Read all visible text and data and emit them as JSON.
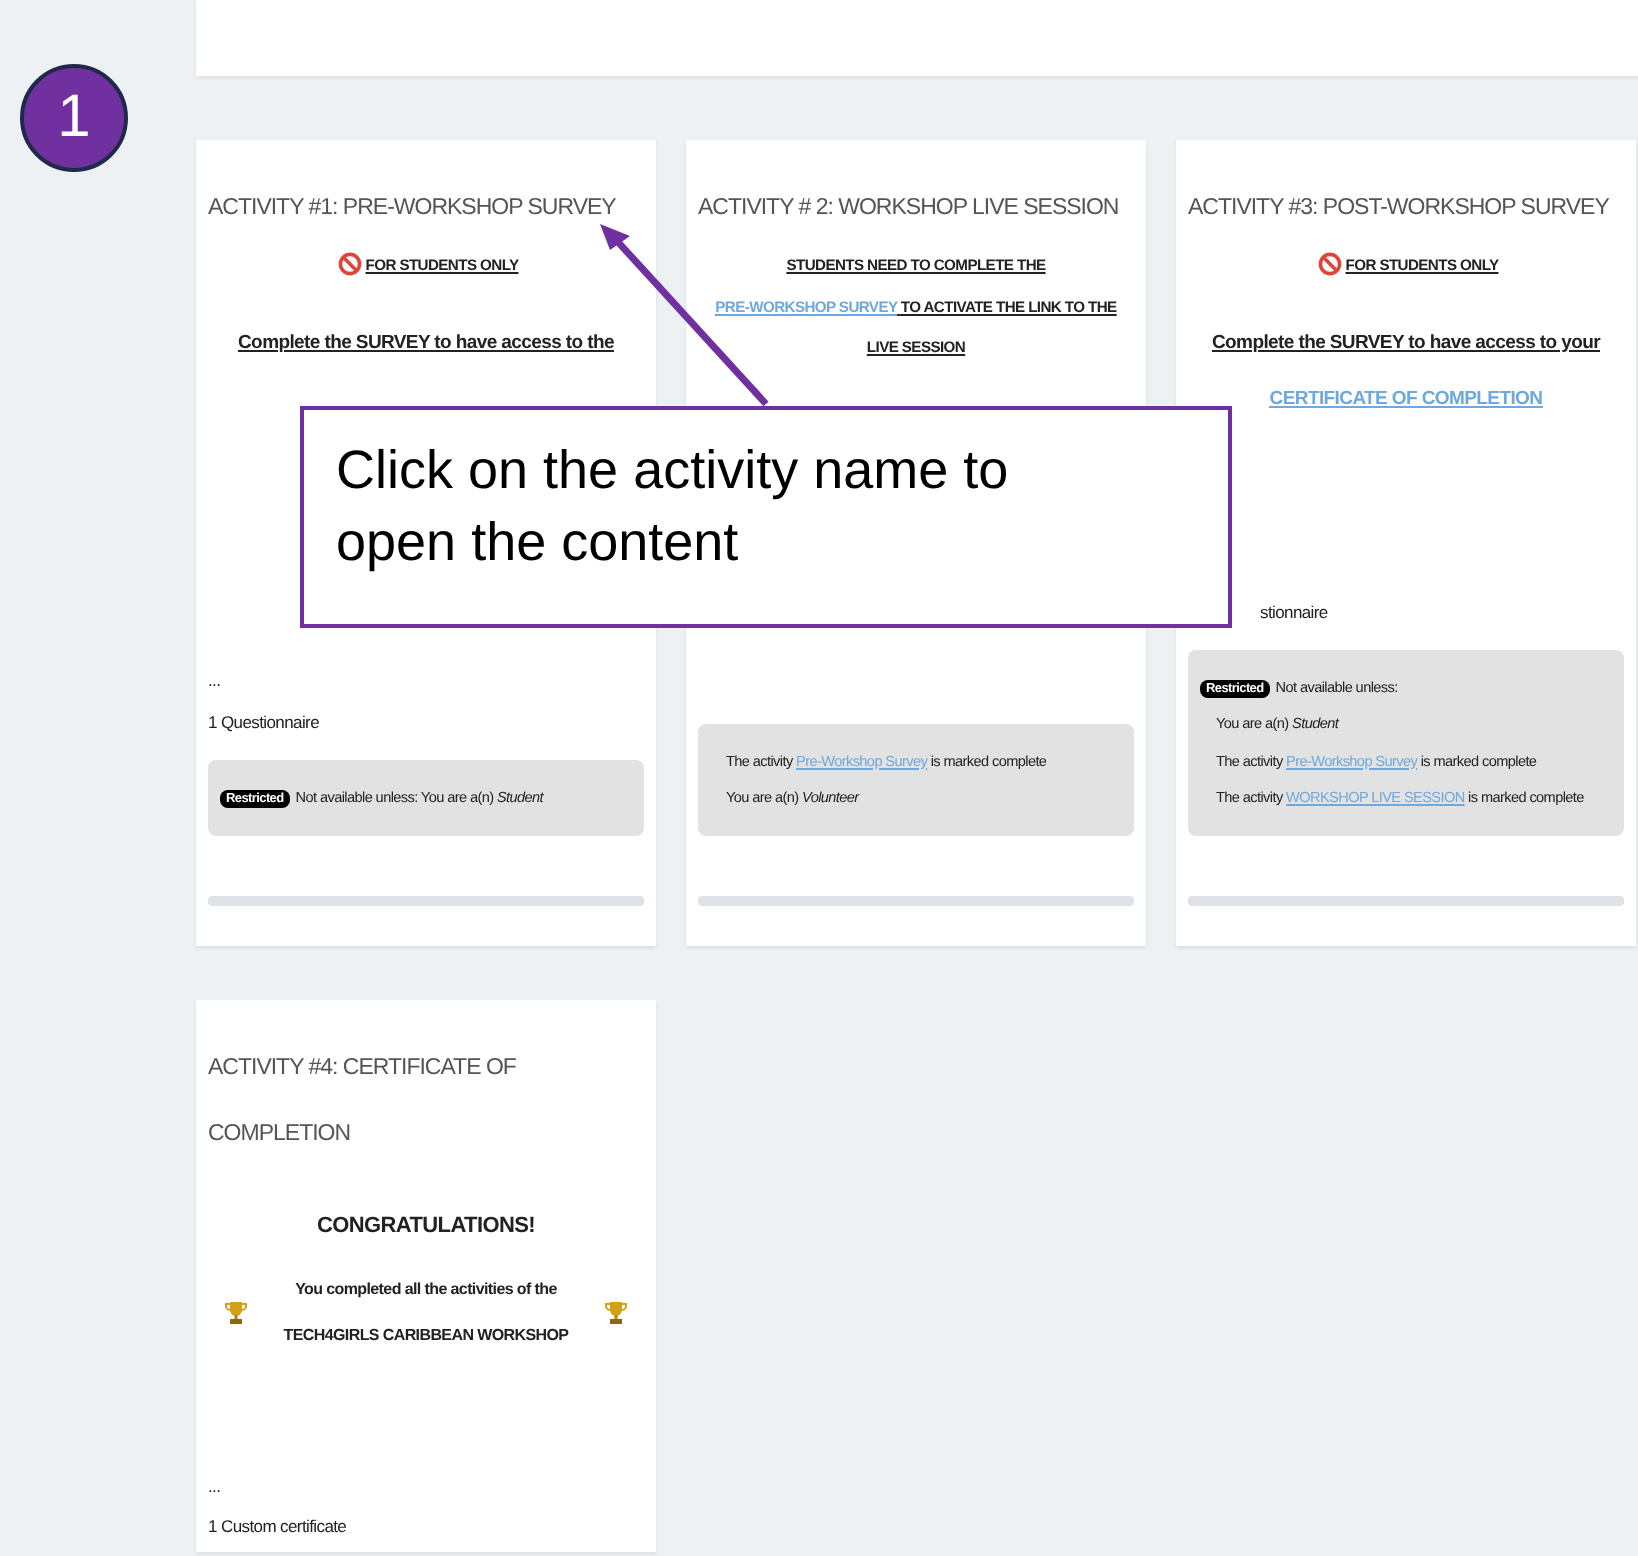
{
  "step_badge": "1",
  "callout": {
    "text": "Click on the activity name to open the content"
  },
  "activities": [
    {
      "title": "ACTIVITY #1: PRE-WORKSHOP SURVEY",
      "blocks": [
        {
          "kind": "notice",
          "segments": [
            {
              "text": "FOR STUDENTS ONLY",
              "link": false
            }
          ]
        },
        {
          "kind": "heading",
          "segments": [
            {
              "text": "Complete the SURVEY to have access to the",
              "link": false
            }
          ]
        }
      ],
      "meta": [
        "...",
        "1 Questionnaire"
      ],
      "restriction": {
        "badge": "Restricted",
        "intro": "Not available unless: You are a(n) *Student*"
      }
    },
    {
      "title": "ACTIVITY # 2: WORKSHOP LIVE SESSION",
      "blocks": [
        {
          "kind": "notice_plain",
          "segments": [
            {
              "text": "STUDENTS NEED TO COMPLETE THE",
              "link": false
            },
            {
              "text": "PRE-WORKSHOP SURVEY",
              "link": true
            },
            {
              "text": "TO ACTIVATE THE LINK TO THE LIVE SESSION",
              "link": false
            }
          ]
        }
      ],
      "restriction": {
        "conditions": [
          [
            {
              "text": "The activity",
              "link": false
            },
            {
              "text": "Pre-Workshop Survey",
              "link": true
            },
            {
              "text": "is marked complete",
              "link": false
            }
          ],
          [
            {
              "text": "You are a(n) *Volunteer*",
              "link": false
            }
          ]
        ]
      }
    },
    {
      "title": "ACTIVITY #3: POST-WORKSHOP SURVEY",
      "blocks": [
        {
          "kind": "notice",
          "segments": [
            {
              "text": "FOR STUDENTS ONLY",
              "link": false
            }
          ]
        },
        {
          "kind": "heading",
          "segments": [
            {
              "text": "Complete the SURVEY to have access to your",
              "link": false
            },
            {
              "text": "CERTIFICATE OF COMPLETION",
              "link": true
            }
          ]
        }
      ],
      "meta": [
        "stionnaire"
      ],
      "restriction": {
        "badge": "Restricted",
        "intro": "Not available unless:",
        "conditions": [
          [
            {
              "text": "You are a(n) *Student*",
              "link": false
            }
          ],
          [
            {
              "text": "The activity",
              "link": false
            },
            {
              "text": "Pre-Workshop Survey",
              "link": true
            },
            {
              "text": "is marked complete",
              "link": false
            }
          ],
          [
            {
              "text": "The activity",
              "link": false
            },
            {
              "text": "WORKSHOP LIVE SESSION",
              "link": true
            },
            {
              "text": "is marked complete",
              "link": false
            }
          ]
        ]
      }
    },
    {
      "title": "ACTIVITY #4: CERTIFICATE OF COMPLETION",
      "blocks": [
        {
          "kind": "congrats",
          "segments": [
            {
              "text": "CONGRATULATIONS!",
              "link": false
            }
          ]
        },
        {
          "kind": "trophy",
          "segments": [
            {
              "text": "You completed all the activities of the TECH4GIRLS CARIBBEAN WORKSHOP",
              "link": false
            }
          ]
        }
      ],
      "meta": [
        "...",
        "1 Custom certificate"
      ]
    }
  ]
}
